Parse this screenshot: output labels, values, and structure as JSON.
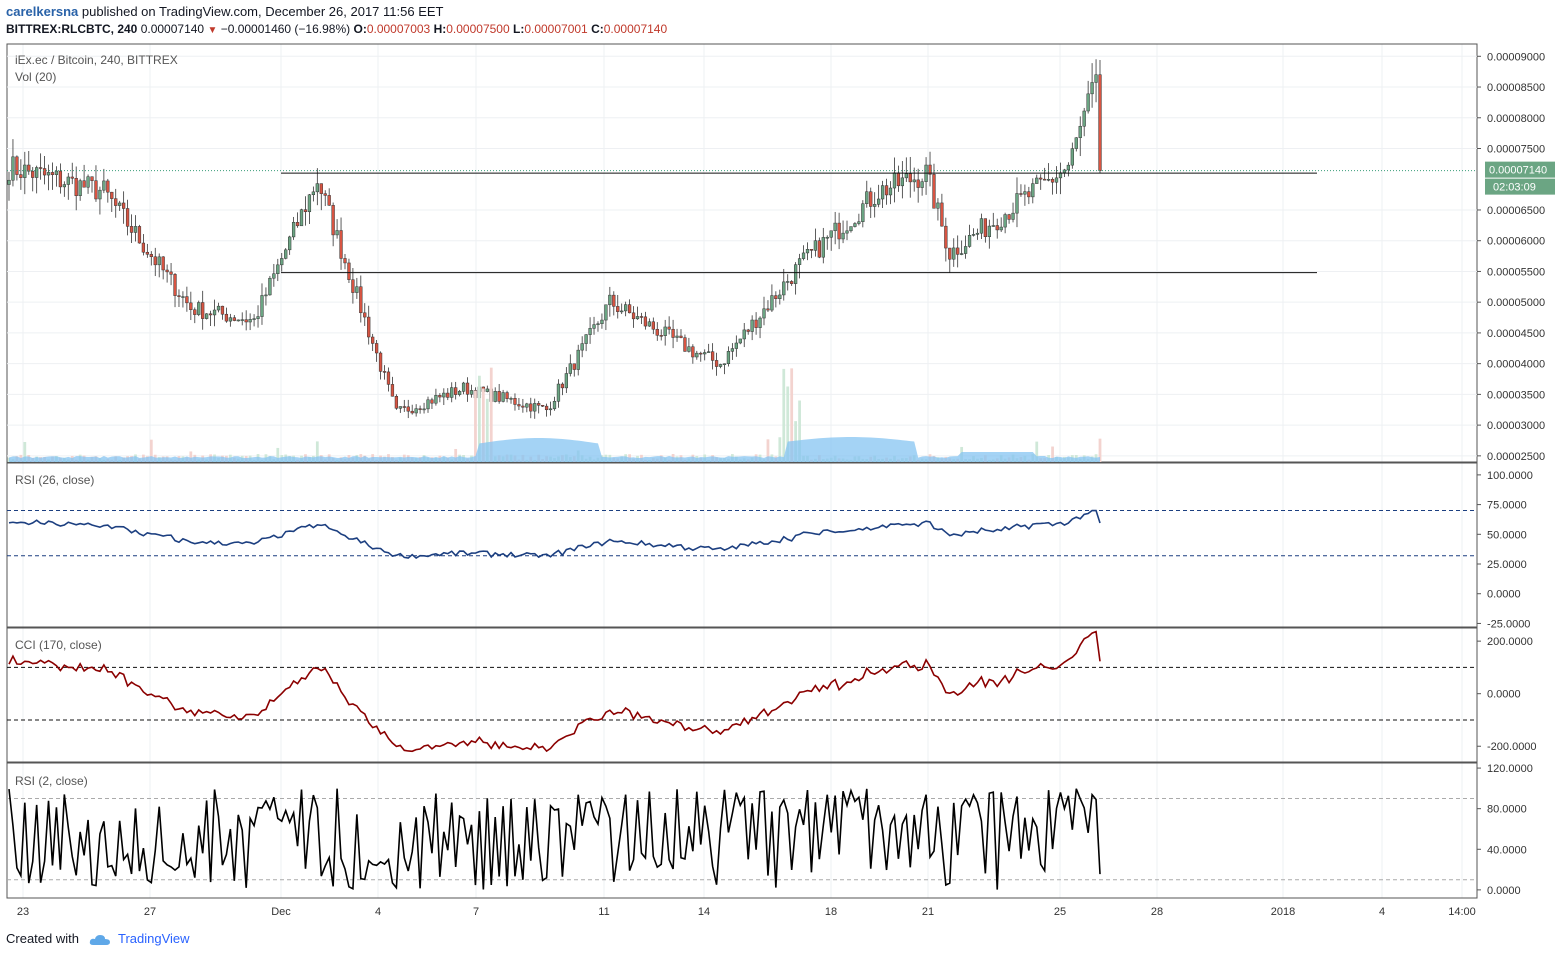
{
  "header": {
    "user": "carelkersna",
    "published_text": "published on TradingView.com, December 26, 2017 11:56 EET",
    "symbol": "BITTREX:RLCBTC, 240",
    "last": "0.00007140",
    "change": "−0.00001460 (−16.98%)",
    "o_label": "O:",
    "o_val": "0.00007003",
    "h_label": "H:",
    "h_val": "0.00007500",
    "l_label": "L:",
    "l_val": "0.00007001",
    "c_label": "C:",
    "c_val": "0.00007140"
  },
  "main_pane": {
    "title": "iEx.ec / Bitcoin, 240, BITTREX",
    "vol_label": "Vol (20)",
    "price_axis": [
      "0.00009000",
      "0.00008500",
      "0.00008000",
      "0.00007500",
      "0.00006500",
      "0.00006000",
      "0.00005500",
      "0.00005000",
      "0.00004500",
      "0.00004000",
      "0.00003500",
      "0.00003000",
      "0.00002500"
    ],
    "last_price_tag": "0.00007140",
    "countdown_tag": "02:03:09",
    "horizontal_lines": [
      7.1e-05,
      5.48e-05
    ]
  },
  "rsi26_pane": {
    "title": "RSI (26, close)",
    "axis": [
      "100.0000",
      "75.0000",
      "50.0000",
      "25.0000",
      "0.0000",
      "-25.0000"
    ],
    "bands": [
      70,
      32
    ]
  },
  "cci_pane": {
    "title": "CCI (170, close)",
    "axis": [
      "200.0000",
      "0.0000",
      "-200.0000"
    ],
    "bands": [
      100,
      -100
    ]
  },
  "rsi2_pane": {
    "title": "RSI (2, close)",
    "axis": [
      "120.0000",
      "80.0000",
      "40.0000",
      "0.0000"
    ],
    "bands": [
      90,
      10
    ]
  },
  "time_axis": [
    "23",
    "27",
    "Dec",
    "4",
    "7",
    "11",
    "14",
    "18",
    "21",
    "25",
    "28",
    "2018",
    "4",
    "14:00"
  ],
  "footer": {
    "created": "Created with",
    "brand": "TradingView"
  },
  "colors": {
    "up": "#6ba583",
    "down": "#d75442",
    "rsi": "#1c3f80",
    "cci": "#8b0000",
    "rsi2": "#000000",
    "volume_ma": "#86c4f2"
  },
  "chart_data": [
    {
      "type": "candlestick",
      "title": "iEx.ec / Bitcoin, 240, BITTREX",
      "ylim": [
        2.4e-05,
        9.2e-05
      ],
      "anchors_x_index": [
        0,
        24,
        46,
        62,
        78,
        98,
        115,
        136,
        152,
        173,
        180
      ],
      "anchors_close": [
        7.2e-05,
        6.8e-05,
        4.9e-05,
        4.7e-05,
        7e-05,
        3.2e-05,
        3.6e-05,
        3.25e-05,
        5e-05,
        4.2e-05,
        4e-05
      ],
      "anchors_x_index_2": [
        200,
        220,
        232,
        238,
        255,
        268,
        275
      ],
      "anchors_close_2": [
        5.6e-05,
        6.8e-05,
        7.1e-05,
        5.8e-05,
        6.6e-05,
        7.2e-05,
        8.6e-05
      ],
      "final_bar_close": 7.14e-05
    },
    {
      "type": "line",
      "title": "RSI (26, close)",
      "ylim": [
        -25,
        110
      ],
      "approx_range": [
        32,
        68
      ]
    },
    {
      "type": "line",
      "title": "CCI (170, close)",
      "ylim": [
        -250,
        250
      ],
      "approx_range": [
        -230,
        240
      ]
    },
    {
      "type": "line",
      "title": "RSI (2, close)",
      "ylim": [
        -10,
        125
      ],
      "approx_range": [
        0,
        100
      ]
    }
  ]
}
